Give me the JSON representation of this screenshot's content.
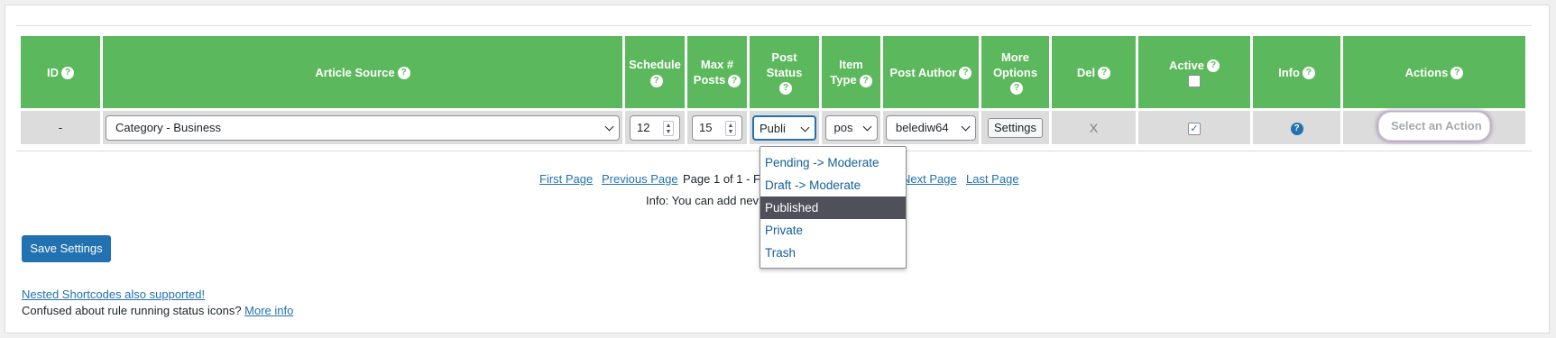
{
  "headers": {
    "id": "ID",
    "article_source": "Article Source",
    "schedule": "Schedule",
    "max_posts_1": "Max #",
    "max_posts_2": "Posts",
    "post_status": "Post Status",
    "item_type_1": "Item",
    "item_type_2": "Type",
    "post_author": "Post Author",
    "more_options_1": "More",
    "more_options_2": "Options",
    "del": "Del",
    "active": "Active",
    "info": "Info",
    "actions": "Actions",
    "help_glyph": "?"
  },
  "row": {
    "id": "-",
    "article_source": "Category - Business",
    "schedule": "12",
    "max_posts": "15",
    "post_status": "Publi",
    "item_type": "pos",
    "post_author": "belediw64",
    "settings_label": "Settings",
    "del": "X",
    "active_checked": true,
    "active_mark": "✓",
    "info_glyph": "?",
    "actions_placeholder": "Select an Action"
  },
  "post_status_options": [
    {
      "label": "Pending -> Moderate",
      "selected": false
    },
    {
      "label": "Draft -> Moderate",
      "selected": false
    },
    {
      "label": "Published",
      "selected": true
    },
    {
      "label": "Private",
      "selected": false
    },
    {
      "label": "Trash",
      "selected": false
    }
  ],
  "pagination": {
    "first": "First Page",
    "previous": "Previous Page",
    "status": "Page 1 of 1 - F",
    "next": "Next Page",
    "last": "Last Page"
  },
  "info_line": "Info: You can add nev",
  "save_button": "Save Settings",
  "footer": {
    "nested_link": "Nested Shortcodes also supported!",
    "confused_text": "Confused about rule running status icons?",
    "more_info_link": "More info"
  },
  "colors": {
    "header_green": "#5cb85c",
    "primary_blue": "#2271b1",
    "selected_option": "#50505a"
  },
  "icons": {
    "help": "question-circle-icon",
    "chevron": "chevron-down-icon",
    "checkbox": "checkbox-icon",
    "info": "info-circle-icon"
  }
}
